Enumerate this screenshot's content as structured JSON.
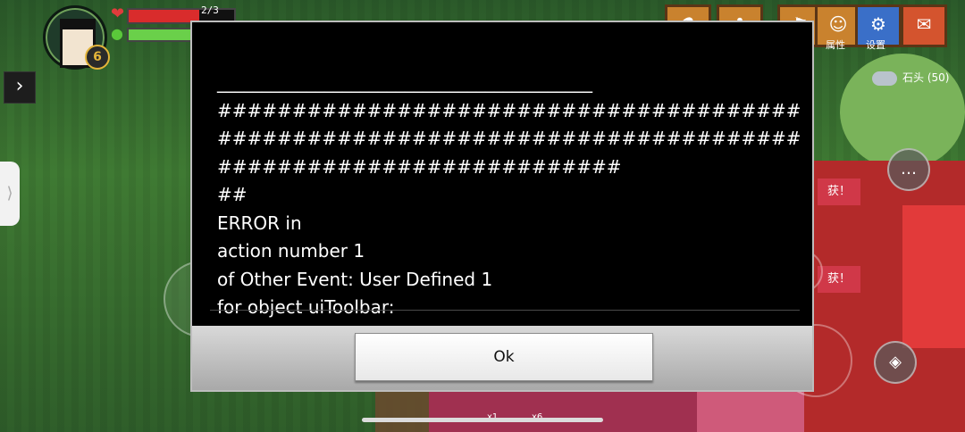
{
  "hud": {
    "hp_text": "2/3",
    "hp_fraction": 0.67,
    "energy_fraction": 0.85,
    "level": "6",
    "icons": [
      "heart-icon",
      "energy-icon",
      "expand-arrow-icon"
    ]
  },
  "toolbar": {
    "attributes_label": "属性",
    "settings_label": "设置"
  },
  "resource": {
    "stone_label": "石头 (50)"
  },
  "background_banners": {
    "text1": "获！",
    "text2": "获！"
  },
  "hotbar": {
    "slot1_count": "x1",
    "slot2_count": "x6"
  },
  "dialog": {
    "message": "__________________________________________\n#########################################################################################################\n##\nERROR in\naction number 1\nof Other Event: User Defined 1\nfor object uiToolbar:",
    "ok_label": "Ok"
  },
  "colors": {
    "dialog_bg": "#000000",
    "footer": "#b8b8b8",
    "hp": "#d92c2c",
    "energy": "#6ad04a"
  }
}
